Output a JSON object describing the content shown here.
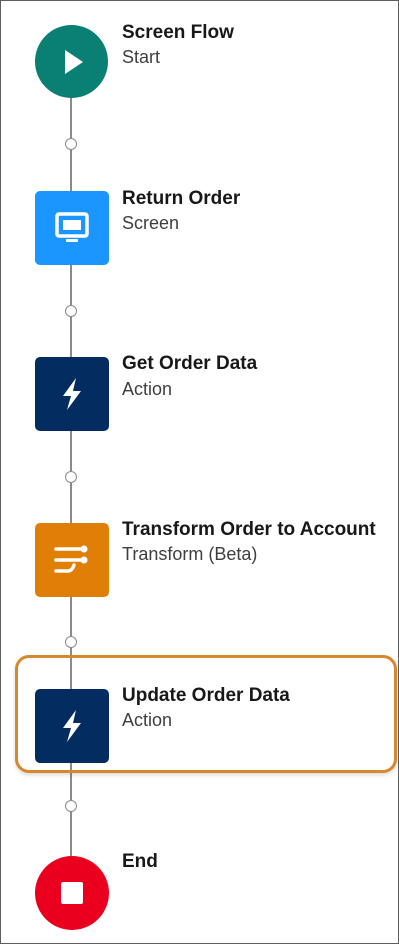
{
  "colors": {
    "start": "#0a7f73",
    "screen": "#1b96ff",
    "action": "#032d60",
    "transform": "#e07f06",
    "end": "#ea001e",
    "highlight": "#d7882d"
  },
  "nodes": [
    {
      "title": "Screen Flow",
      "subtitle": "Start",
      "icon": "play-icon"
    },
    {
      "title": "Return Order",
      "subtitle": "Screen",
      "icon": "screen-icon"
    },
    {
      "title": "Get Order Data",
      "subtitle": "Action",
      "icon": "lightning-icon"
    },
    {
      "title": "Transform Order to Account",
      "subtitle": "Transform (Beta)",
      "icon": "transform-icon"
    },
    {
      "title": "Update Order Data",
      "subtitle": "Action",
      "icon": "lightning-icon",
      "selected": true
    },
    {
      "title": "End",
      "subtitle": "",
      "icon": "stop-icon"
    }
  ]
}
